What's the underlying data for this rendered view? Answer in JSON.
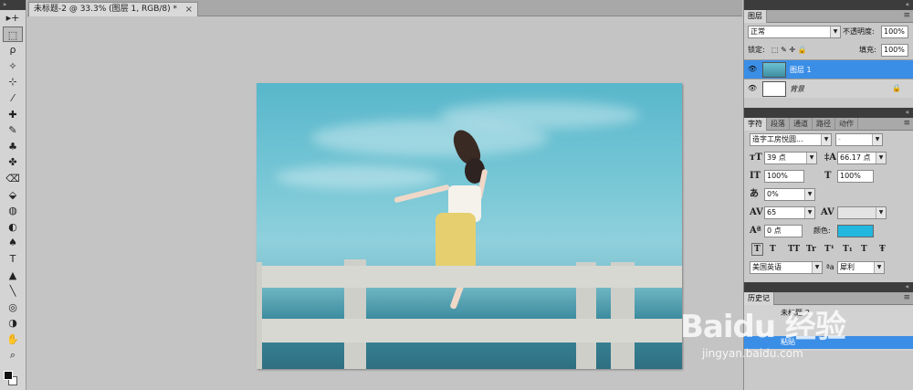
{
  "toolbox": {
    "tools": [
      "move-tool",
      "marquee-tool",
      "lasso-tool",
      "magic-wand-tool",
      "crop-tool",
      "eyedropper-tool",
      "healing-brush-tool",
      "brush-tool",
      "clone-stamp-tool",
      "history-brush-tool",
      "eraser-tool",
      "paint-bucket-tool",
      "blur-tool",
      "dodge-tool",
      "pen-tool",
      "type-tool",
      "path-selection-tool",
      "line-tool",
      "rotate-3d-tool",
      "rotate-3d-view-tool",
      "hand-tool",
      "zoom-tool"
    ],
    "glyphs": [
      "▸+",
      "⬚",
      "ρ",
      "✧",
      "⊹",
      "⁄",
      "✚",
      "✎",
      "♣",
      "✤",
      "⌫",
      "⬙",
      "◍",
      "◐",
      "♠",
      "T",
      "▲",
      "╲",
      "◎",
      "◑",
      "✋",
      "⌕"
    ]
  },
  "document": {
    "tab_title": "未标题-2 @ 33.3% (图层 1, RGB/8) *",
    "close_glyph": "×"
  },
  "layers_panel": {
    "tab": "图层",
    "blend_mode": "正常",
    "opacity_label": "不透明度:",
    "opacity_value": "100%",
    "lock_label": "锁定:",
    "lock_icons": "⬚ ✎ ✛ 🔒",
    "fill_label": "填充:",
    "fill_value": "100%",
    "layers": [
      {
        "name": "图层 1",
        "selected": true
      },
      {
        "name": "背景",
        "selected": false
      }
    ]
  },
  "character_panel": {
    "tabs": [
      "字符",
      "段落",
      "通道",
      "路径",
      "动作"
    ],
    "font_family": "造字工房悦圆...",
    "font_style": "-",
    "font_size": "39 点",
    "leading": "66.17 点",
    "vertical_scale": "100%",
    "horizontal_scale": "100%",
    "tsume": "0%",
    "tracking": "65",
    "kerning": "",
    "baseline_shift": "0 点",
    "color_label": "颜色:",
    "color_value": "#22b7df",
    "style_buttons": [
      "T",
      "T",
      "TT",
      "Tr",
      "T¹",
      "T₁",
      "T",
      "Ŧ"
    ],
    "language": "美国英语",
    "aa_label": "ªa",
    "anti_alias": "犀利"
  },
  "history_panel": {
    "tab": "历史记",
    "items": [
      {
        "label": "未标题-2",
        "selected": false
      },
      {
        "label": "",
        "selected": false
      },
      {
        "label": "粘贴",
        "selected": true
      }
    ]
  },
  "watermark": {
    "brand": "Baidu 经验",
    "url": "jingyan.baidu.com"
  }
}
